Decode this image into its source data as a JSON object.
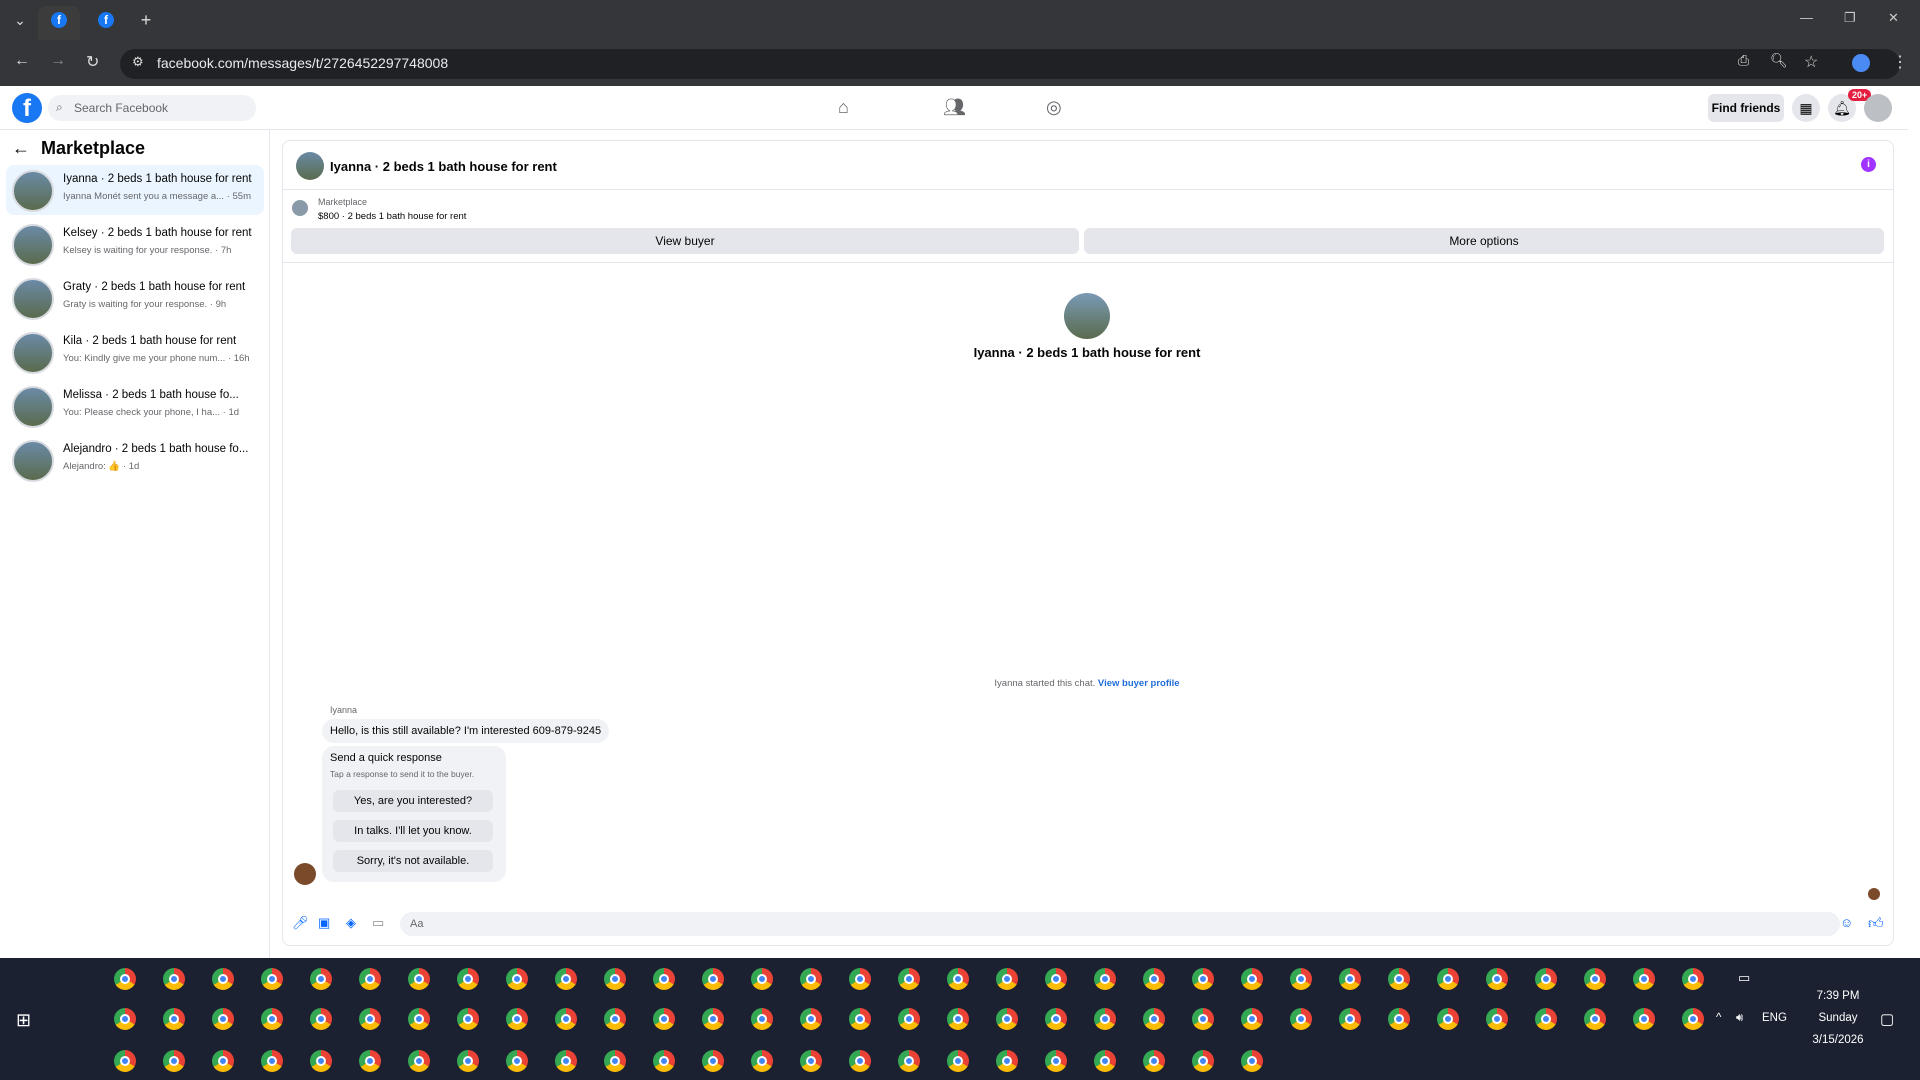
{
  "browser": {
    "tabs": [
      {
        "icon": "facebook-icon"
      },
      {
        "icon": "facebook-icon"
      }
    ],
    "new_tab": "+",
    "url": "facebook.com/messages/t/2726452297748008"
  },
  "fb": {
    "logo": "f",
    "search_placeholder": "Search Facebook",
    "find_friends": "Find friends",
    "notif_badge": "20+"
  },
  "sidebar": {
    "title": "Marketplace",
    "conversations": [
      {
        "title": "Iyanna · 2 beds 1 bath house for rent",
        "snippet": "Iyanna Monét sent you a message a... · 55m",
        "selected": true
      },
      {
        "title": "Kelsey · 2 beds 1 bath house for rent",
        "snippet": "Kelsey is waiting for your response. · 7h"
      },
      {
        "title": "Graty · 2 beds 1 bath house for rent",
        "snippet": "Graty is waiting for your response. · 9h"
      },
      {
        "title": "Kila · 2 beds 1 bath house for rent",
        "snippet": "You: Kindly give me your phone num... · 16h"
      },
      {
        "title": "Melissa · 2 beds 1 bath house fo...",
        "snippet": "You: Please check your phone, I ha... · 1d"
      },
      {
        "title": "Alejandro · 2 beds 1 bath house fo...",
        "snippet": "Alejandro: 👍 · 1d"
      }
    ]
  },
  "chat": {
    "header_title": "Iyanna · 2 beds 1 bath house for rent",
    "info_icon": "i",
    "listing_label": "Marketplace",
    "listing_price": "$800 · 2 beds 1 bath house for rent",
    "view_buyer": "View buyer",
    "more_options": "More options",
    "center_title": "Iyanna · 2 beds 1 bath house for rent",
    "system_msg": "Iyanna started this chat.",
    "system_link": "View buyer profile",
    "sender": "Iyanna",
    "message": "Hello, is this still available? I'm interested 609-879-9245",
    "quick_title": "Send a quick response",
    "quick_sub": "Tap a response to send it to the buyer.",
    "quick_responses": [
      "Yes, are you interested?",
      "In talks. I'll let you know.",
      "Sorry, it's not available."
    ],
    "compose_placeholder": "Aa"
  },
  "taskbar": {
    "lang": "ENG",
    "time": "7:39 PM",
    "day": "Sunday",
    "date": "3/15/2026"
  },
  "colors": {
    "fb_blue": "#1877f2",
    "badge_red": "#e41e3f",
    "link": "#216fdb",
    "info_purple": "#a033ff"
  }
}
